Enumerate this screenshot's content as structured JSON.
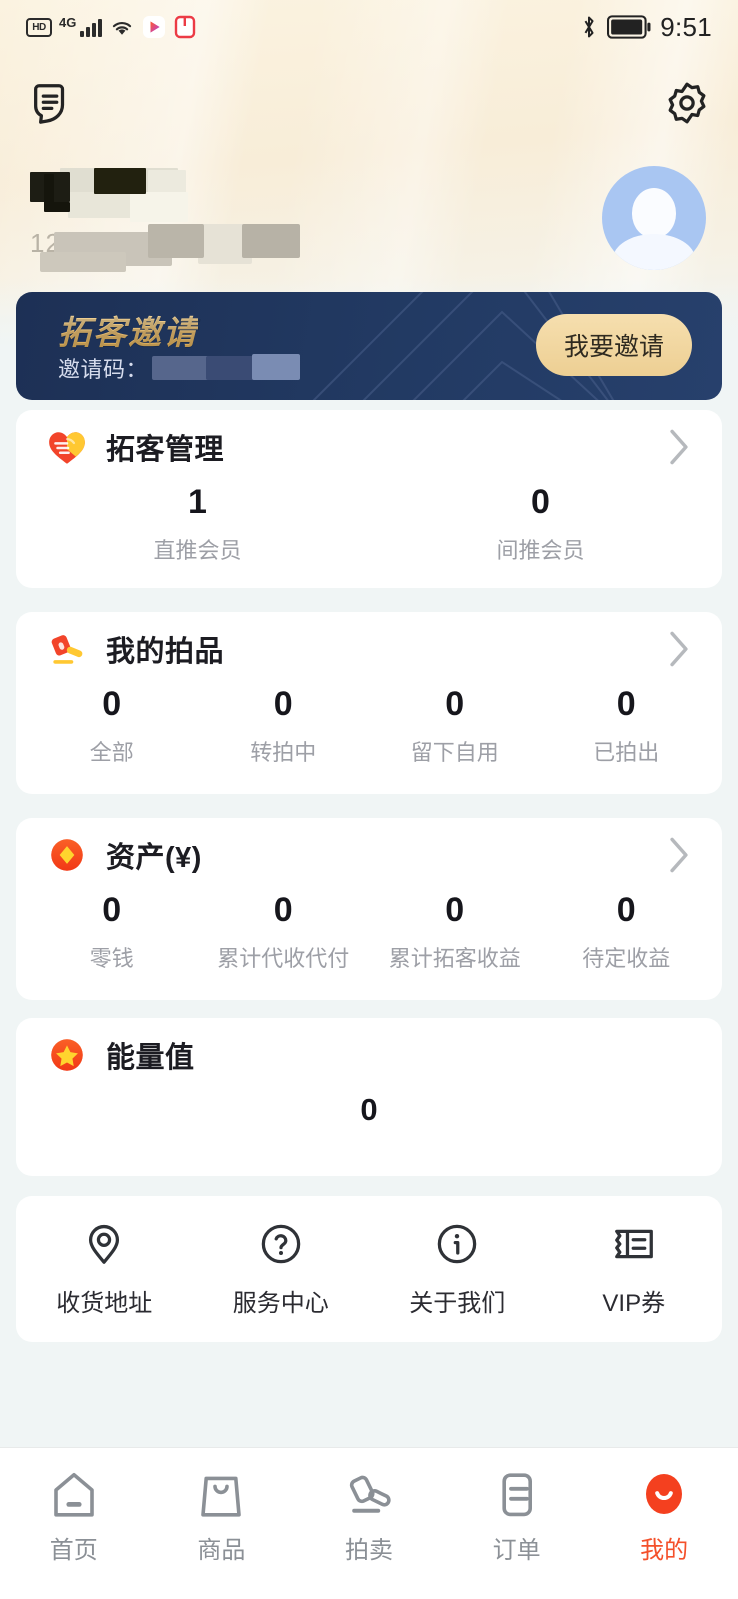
{
  "status_bar": {
    "hd_label": "HD",
    "network_label": "4G",
    "time": "9:51",
    "icons": [
      "hd-icon",
      "signal-bars-icon",
      "wifi-icon",
      "video-app-icon",
      "book-app-icon",
      "bluetooth-icon",
      "battery-icon"
    ]
  },
  "header": {
    "notes_icon": "notes-icon",
    "settings_icon": "gear-icon",
    "username_redacted": true,
    "phone_prefix": "12",
    "phone_redacted": true,
    "avatar_icon": "default-avatar-icon"
  },
  "banner": {
    "title": "拓客邀请",
    "code_label": "邀请码：",
    "code_redacted": true,
    "invite_button": "我要邀请",
    "bg_color": "#223a63",
    "accent_color": "#edcf93"
  },
  "cards": [
    {
      "id": "tuoke",
      "icon": "handshake-heart-icon",
      "title": "拓客管理",
      "has_chevron": true,
      "stats": [
        {
          "value": "1",
          "label": "直推会员"
        },
        {
          "value": "0",
          "label": "间推会员"
        }
      ]
    },
    {
      "id": "paipin",
      "icon": "gavel-icon",
      "title": "我的拍品",
      "has_chevron": true,
      "stats": [
        {
          "value": "0",
          "label": "全部"
        },
        {
          "value": "0",
          "label": "转拍中"
        },
        {
          "value": "0",
          "label": "留下自用"
        },
        {
          "value": "0",
          "label": "已拍出"
        }
      ]
    },
    {
      "id": "zichan",
      "icon": "coin-diamond-icon",
      "title": "资产(¥)",
      "has_chevron": true,
      "stats": [
        {
          "value": "0",
          "label": "零钱"
        },
        {
          "value": "0",
          "label": "累计代收代付"
        },
        {
          "value": "0",
          "label": "累计拓客收益"
        },
        {
          "value": "0",
          "label": "待定收益"
        }
      ]
    },
    {
      "id": "nengliang",
      "icon": "star-circle-icon",
      "title": "能量值",
      "has_chevron": false,
      "value": "0"
    }
  ],
  "quick_links": [
    {
      "icon": "location-pin-icon",
      "label": "收货地址"
    },
    {
      "icon": "question-circle-icon",
      "label": "服务中心"
    },
    {
      "icon": "info-circle-icon",
      "label": "关于我们"
    },
    {
      "icon": "ticket-icon",
      "label": "VIP券"
    }
  ],
  "tabbar": {
    "active_color": "#f4502a",
    "items": [
      {
        "icon": "home-icon",
        "label": "首页",
        "active": false
      },
      {
        "icon": "bag-icon",
        "label": "商品",
        "active": false
      },
      {
        "icon": "gavel-outline-icon",
        "label": "拍卖",
        "active": false
      },
      {
        "icon": "order-list-icon",
        "label": "订单",
        "active": false
      },
      {
        "icon": "profile-smile-icon",
        "label": "我的",
        "active": true
      }
    ]
  }
}
